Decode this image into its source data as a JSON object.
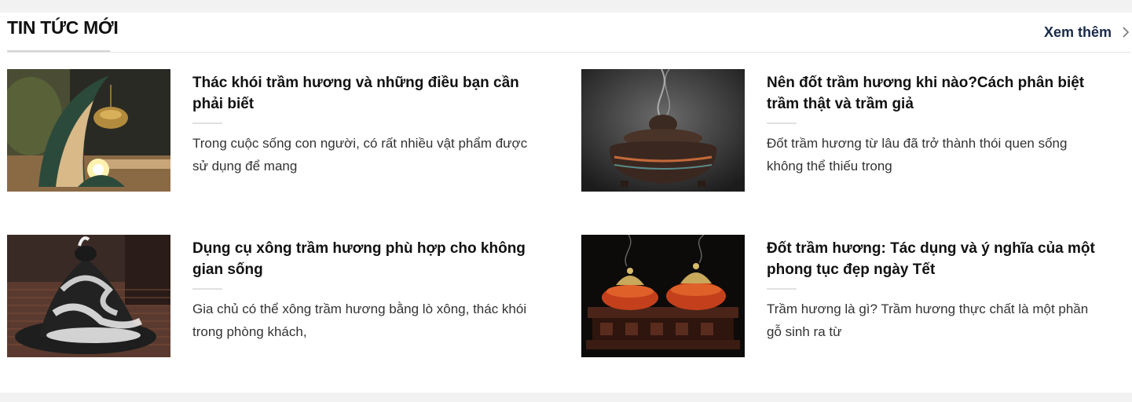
{
  "section": {
    "title": "TIN TỨC MỚI",
    "more_label": "Xem thêm",
    "more_icon": "chevron-right-icon"
  },
  "articles": [
    {
      "title": "Thác khói trầm hương và những điều bạn cần phải biết",
      "excerpt": "Trong cuộc sống con người, có rất nhiều vật phẩm được sử dụng để mang"
    },
    {
      "title": "Nên đốt trầm hương khi nào?Cách phân biệt trầm thật và trầm giả",
      "excerpt": "Đốt trầm hương từ lâu đã trở thành thói quen sống không thể thiếu trong"
    },
    {
      "title": "Dụng cụ xông trầm hương phù hợp cho không gian sống",
      "excerpt": "Gia chủ có thể xông trầm hương bằng lò xông, thác khói trong phòng khách,"
    },
    {
      "title": "Đốt trầm hương: Tác dụng và ý nghĩa của một phong tục đẹp ngày Tết",
      "excerpt": "Trầm hương là gì? Trầm hương thực chất là một phần gỗ sinh ra từ"
    }
  ]
}
